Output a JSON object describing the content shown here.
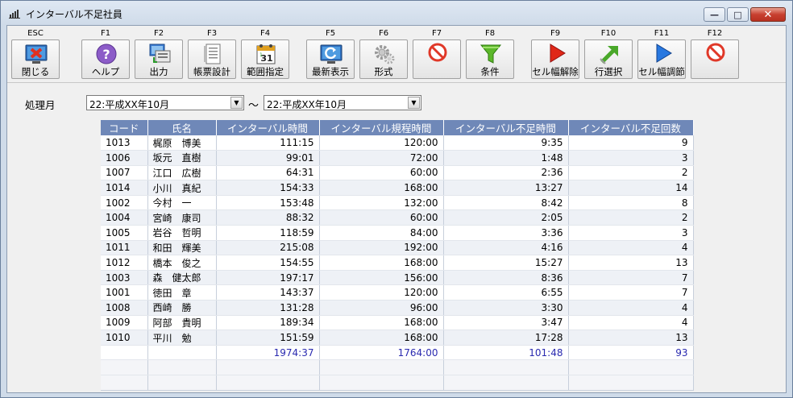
{
  "window": {
    "title": "インターバル不足社員",
    "min_glyph": "—",
    "max_glyph": "□",
    "close_glyph": "✕"
  },
  "toolbar": [
    {
      "key": "ESC",
      "label": "閉じる",
      "icon": "close-window-icon"
    },
    {
      "key": "F1",
      "label": "ヘルプ",
      "icon": "help-icon"
    },
    {
      "key": "F2",
      "label": "出力",
      "icon": "output-icon"
    },
    {
      "key": "F3",
      "label": "帳票設計",
      "icon": "report-design-icon"
    },
    {
      "key": "F4",
      "label": "範囲指定",
      "icon": "calendar-icon"
    },
    {
      "key": "F5",
      "label": "最新表示",
      "icon": "refresh-icon"
    },
    {
      "key": "F6",
      "label": "形式",
      "icon": "gear-icon"
    },
    {
      "key": "F7",
      "label": "",
      "icon": "disabled-icon"
    },
    {
      "key": "F8",
      "label": "条件",
      "icon": "filter-icon"
    },
    {
      "key": "F9",
      "label": "セル幅解除",
      "icon": "play-red-icon"
    },
    {
      "key": "F10",
      "label": "行選択",
      "icon": "arrow-up-right-icon"
    },
    {
      "key": "F11",
      "label": "セル幅調節",
      "icon": "play-blue-icon"
    },
    {
      "key": "F12",
      "label": "",
      "icon": "disabled-icon"
    }
  ],
  "filter": {
    "label": "処理月",
    "from": "22:平成XX年10月",
    "to": "22:平成XX年10月",
    "separator": "～",
    "arrow": "▼"
  },
  "table": {
    "columns": [
      "コード",
      "氏名",
      "インターバル時間",
      "インターバル規程時間",
      "インターバル不足時間",
      "インターバル不足回数"
    ],
    "rows": [
      [
        "1013",
        "梶原　博美",
        "111:15",
        "120:00",
        "9:35",
        "9"
      ],
      [
        "1006",
        "坂元　直樹",
        "99:01",
        "72:00",
        "1:48",
        "3"
      ],
      [
        "1007",
        "江口　広樹",
        "64:31",
        "60:00",
        "2:36",
        "2"
      ],
      [
        "1014",
        "小川　真紀",
        "154:33",
        "168:00",
        "13:27",
        "14"
      ],
      [
        "1002",
        "今村　一",
        "153:48",
        "132:00",
        "8:42",
        "8"
      ],
      [
        "1004",
        "宮崎　康司",
        "88:32",
        "60:00",
        "2:05",
        "2"
      ],
      [
        "1005",
        "岩谷　哲明",
        "118:59",
        "84:00",
        "3:36",
        "3"
      ],
      [
        "1011",
        "和田　輝美",
        "215:08",
        "192:00",
        "4:16",
        "4"
      ],
      [
        "1012",
        "橋本　俊之",
        "154:55",
        "168:00",
        "15:27",
        "13"
      ],
      [
        "1003",
        "森　健太郎",
        "197:17",
        "156:00",
        "8:36",
        "7"
      ],
      [
        "1001",
        "徳田　章",
        "143:37",
        "120:00",
        "6:55",
        "7"
      ],
      [
        "1008",
        "西崎　勝",
        "131:28",
        "96:00",
        "3:30",
        "4"
      ],
      [
        "1009",
        "阿部　貴明",
        "189:34",
        "168:00",
        "3:47",
        "4"
      ],
      [
        "1010",
        "平川　勉",
        "151:59",
        "168:00",
        "17:28",
        "13"
      ]
    ],
    "totals": [
      "",
      "",
      "1974:37",
      "1764:00",
      "101:48",
      "93"
    ]
  },
  "colors": {
    "header_bg": "#6f88b8",
    "total_text": "#2a2ab0",
    "close_red": "#c84030"
  }
}
